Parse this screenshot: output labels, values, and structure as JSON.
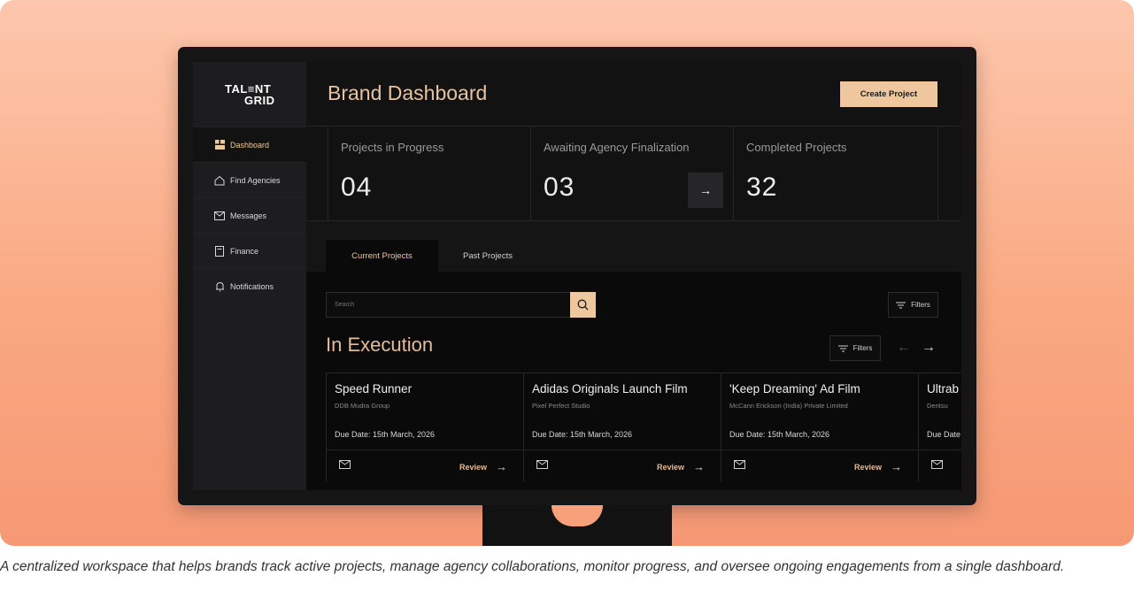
{
  "app": {
    "logo_line1": "TAL≡NT",
    "logo_line2": "GRID"
  },
  "sidebar": {
    "items": [
      {
        "label": "Dashboard",
        "icon": "dashboard-grid-icon",
        "active": true
      },
      {
        "label": "Find Agencies",
        "icon": "home-icon",
        "active": false
      },
      {
        "label": "Messages",
        "icon": "mail-icon",
        "active": false
      },
      {
        "label": "Finance",
        "icon": "document-icon",
        "active": false
      },
      {
        "label": "Notifications",
        "icon": "bell-icon",
        "active": false
      }
    ]
  },
  "header": {
    "title": "Brand Dashboard",
    "create_label": "Create Project"
  },
  "stats": [
    {
      "label": "Projects in Progress",
      "value": "04"
    },
    {
      "label": "Awaiting Agency Finalization",
      "value": "03"
    },
    {
      "label": "Completed Projects",
      "value": "32"
    }
  ],
  "tabs": [
    {
      "label": "Current Projects",
      "active": true
    },
    {
      "label": "Past Projects",
      "active": false
    }
  ],
  "search": {
    "placeholder": "Search"
  },
  "filters_label": "Filters",
  "section": {
    "title": "In Execution"
  },
  "pager": {
    "prev": "←",
    "next": "→"
  },
  "projects": [
    {
      "title": "Speed Runner",
      "agency": "DDB Mudra Group",
      "due": "Due Date: 15th March, 2026",
      "action": "Review"
    },
    {
      "title": "Adidas Originals Launch Film",
      "agency": "Pixel Perfect Studio",
      "due": "Due Date: 15th March, 2026",
      "action": "Review"
    },
    {
      "title": "'Keep Dreaming' Ad Film",
      "agency": "McCann Erickson (India) Private Limited",
      "due": "Due Date: 15th March, 2026",
      "action": "Review"
    },
    {
      "title": "Ultrab",
      "agency": "Dentsu",
      "due": "Due Date",
      "action": ""
    }
  ],
  "caption": "A centralized workspace that helps brands track active projects, manage agency collaborations, monitor progress, and oversee ongoing engagements from a single dashboard.",
  "colors": {
    "accent": "#efc79f",
    "background_gradient_top": "#fdc7ad",
    "background_gradient_bottom": "#f69874",
    "sidebar": "#1d1d1f",
    "panel": "#121212"
  }
}
